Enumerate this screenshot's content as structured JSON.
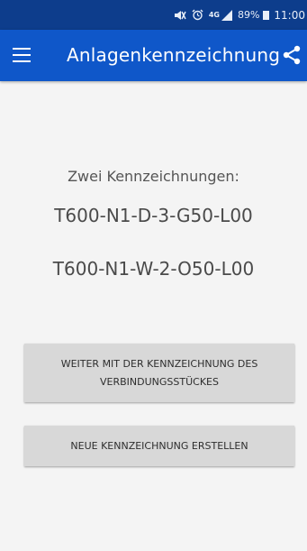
{
  "status_bar": {
    "network": "4G",
    "battery_percent": "89%",
    "time": "11:00",
    "icons": [
      "mute-icon",
      "alarm-icon",
      "signal-icon",
      "battery-icon"
    ]
  },
  "app_bar": {
    "title": "Anlagenkennzeichnung",
    "menu_icon": "hamburger-menu-icon",
    "share_icon": "share-icon"
  },
  "main": {
    "subtitle": "Zwei Kennzeichnungen:",
    "codes": [
      "T600-N1-D-3-G50-L00",
      "T600-N1-W-2-O50-L00"
    ],
    "buttons": {
      "continue": "WEITER MIT DER KENNZEICHNUNG DES VERBINDUNGSSTÜCKES",
      "new": "NEUE KENNZEICHNUNG ERSTELLEN"
    }
  },
  "colors": {
    "status_bar": "#0d3d8c",
    "app_bar": "#0f57c9",
    "background": "#f4f4f4",
    "button": "#d8d8d8"
  }
}
